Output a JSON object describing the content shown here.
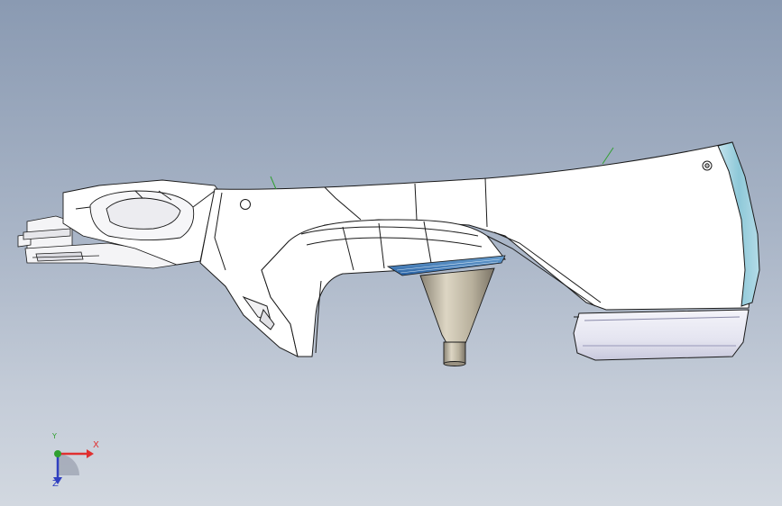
{
  "viewport": {
    "background_top": "#8a9ab2",
    "background_bottom": "#d2d8e0"
  },
  "triad": {
    "x_label": "X",
    "y_label": "Y",
    "z_label": "Z",
    "x_color": "#e03030",
    "y_color": "#30a030",
    "z_color": "#3040c0"
  },
  "model": {
    "icon": "cad-part-model",
    "body_color": "#ffffff",
    "edge_color": "#1a1a1a",
    "accent_color": "#8ec8d8",
    "grille_color": "#3a78b8",
    "stand_color": "#c8bfa8"
  }
}
